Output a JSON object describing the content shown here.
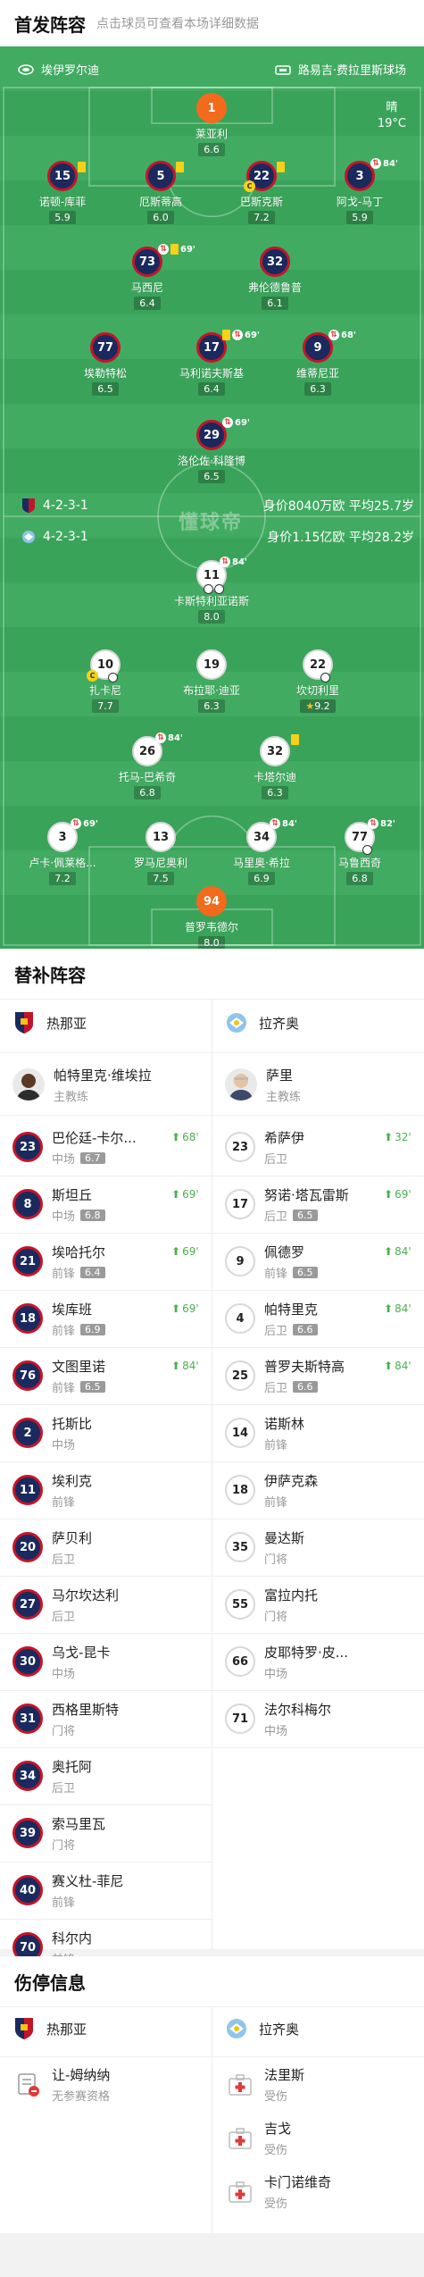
{
  "header": {
    "title": "首发阵容",
    "subtitle": "点击球员可查看本场详细数据"
  },
  "venue": {
    "home_name": "埃伊罗尔迪",
    "away_name": "路易吉·费拉里斯球场",
    "weather_label": "晴",
    "temperature": "19°C"
  },
  "watermark": "懂球帝",
  "home_team": {
    "formation": "4-2-3-1",
    "market_value": "身价8040万欧",
    "avg_age": "平均25.7岁"
  },
  "away_team": {
    "formation": "4-2-3-1",
    "market_value": "身价1.15亿欧",
    "avg_age": "平均28.2岁"
  },
  "home_players": [
    {
      "num": "1",
      "name": "莱亚利",
      "rating": "6.6"
    },
    {
      "num": "15",
      "name": "诺顿-库菲",
      "rating": "5.9"
    },
    {
      "num": "5",
      "name": "厄斯蒂高",
      "rating": "6.0"
    },
    {
      "num": "22",
      "name": "巴斯克斯",
      "rating": "7.2"
    },
    {
      "num": "3",
      "name": "阿戈-马丁",
      "rating": "5.9",
      "sub": "84'"
    },
    {
      "num": "73",
      "name": "马西尼",
      "rating": "6.4",
      "sub": "69'"
    },
    {
      "num": "32",
      "name": "弗伦德鲁普",
      "rating": "6.1"
    },
    {
      "num": "77",
      "name": "埃勒特松",
      "rating": "6.5"
    },
    {
      "num": "17",
      "name": "马利诺夫斯基",
      "rating": "6.4",
      "sub": "69'"
    },
    {
      "num": "9",
      "name": "维蒂尼亚",
      "rating": "6.3",
      "sub": "68'"
    },
    {
      "num": "29",
      "name": "洛伦佐·科隆博",
      "rating": "6.5",
      "sub": "69'"
    }
  ],
  "away_players": [
    {
      "num": "11",
      "name": "卡斯特利亚诺斯",
      "rating": "8.0",
      "sub": "84'"
    },
    {
      "num": "10",
      "name": "扎卡尼",
      "rating": "7.7"
    },
    {
      "num": "19",
      "name": "布拉耶·迪亚",
      "rating": "6.3"
    },
    {
      "num": "22",
      "name": "坎切利里",
      "rating": "9.2"
    },
    {
      "num": "26",
      "name": "托马-巴希奇",
      "rating": "6.8",
      "sub": "84'"
    },
    {
      "num": "32",
      "name": "卡塔尔迪",
      "rating": "6.3"
    },
    {
      "num": "3",
      "name": "卢卡·佩莱格...",
      "rating": "7.2",
      "sub": "69'"
    },
    {
      "num": "13",
      "name": "罗马尼奥利",
      "rating": "7.5"
    },
    {
      "num": "34",
      "name": "马里奥·希拉",
      "rating": "6.9",
      "sub": "84'"
    },
    {
      "num": "77",
      "name": "马鲁西奇",
      "rating": "6.8",
      "sub": "82'"
    },
    {
      "num": "94",
      "name": "普罗韦德尔",
      "rating": "8.0"
    }
  ],
  "subs": {
    "title": "替补阵容",
    "home_team": "热那亚",
    "away_team": "拉齐奥",
    "home_coach": {
      "name": "帕特里克·维埃拉",
      "role": "主教练"
    },
    "away_coach": {
      "name": "萨里",
      "role": "主教练"
    },
    "home": [
      {
        "num": "23",
        "name": "巴伦廷-卡尔...",
        "pos": "中场",
        "rating": "6.7",
        "in": "68'"
      },
      {
        "num": "8",
        "name": "斯坦丘",
        "pos": "中场",
        "rating": "6.8",
        "in": "69'"
      },
      {
        "num": "21",
        "name": "埃哈托尔",
        "pos": "前锋",
        "rating": "6.4",
        "in": "69'"
      },
      {
        "num": "18",
        "name": "埃库班",
        "pos": "前锋",
        "rating": "6.9",
        "in": "69'"
      },
      {
        "num": "76",
        "name": "文图里诺",
        "pos": "前锋",
        "rating": "6.5",
        "in": "84'"
      },
      {
        "num": "2",
        "name": "托斯比",
        "pos": "中场"
      },
      {
        "num": "11",
        "name": "埃利克",
        "pos": "前锋"
      },
      {
        "num": "20",
        "name": "萨贝利",
        "pos": "后卫"
      },
      {
        "num": "27",
        "name": "马尔坎达利",
        "pos": "后卫"
      },
      {
        "num": "30",
        "name": "乌戈-昆卡",
        "pos": "中场"
      },
      {
        "num": "31",
        "name": "西格里斯特",
        "pos": "门将"
      },
      {
        "num": "34",
        "name": "奥托阿",
        "pos": "后卫"
      },
      {
        "num": "39",
        "name": "索马里瓦",
        "pos": "门将"
      },
      {
        "num": "40",
        "name": "赛义杜-菲尼",
        "pos": "前锋"
      },
      {
        "num": "70",
        "name": "科尔内",
        "pos": "前锋"
      }
    ],
    "away": [
      {
        "num": "23",
        "name": "希萨伊",
        "pos": "后卫",
        "in": "32'"
      },
      {
        "num": "17",
        "name": "努诺·塔瓦雷斯",
        "pos": "后卫",
        "rating": "6.5",
        "in": "69'"
      },
      {
        "num": "9",
        "name": "佩德罗",
        "pos": "前锋",
        "rating": "6.5",
        "in": "84'"
      },
      {
        "num": "4",
        "name": "帕特里克",
        "pos": "后卫",
        "rating": "6.6",
        "in": "84'"
      },
      {
        "num": "25",
        "name": "普罗夫斯特高",
        "pos": "后卫",
        "rating": "6.6",
        "in": "84'"
      },
      {
        "num": "14",
        "name": "诺斯林",
        "pos": "前锋"
      },
      {
        "num": "18",
        "name": "伊萨克森",
        "pos": "前锋"
      },
      {
        "num": "35",
        "name": "曼达斯",
        "pos": "门将"
      },
      {
        "num": "55",
        "name": "富拉内托",
        "pos": "门将"
      },
      {
        "num": "66",
        "name": "皮耶特罗·皮...",
        "pos": "中场"
      },
      {
        "num": "71",
        "name": "法尔科梅尔",
        "pos": "中场"
      }
    ]
  },
  "injuries": {
    "title": "伤停信息",
    "home_team": "热那亚",
    "away_team": "拉齐奥",
    "home": [
      {
        "name": "让-姆纳纳",
        "status": "无参赛资格"
      }
    ],
    "away": [
      {
        "name": "法里斯",
        "status": "受伤"
      },
      {
        "name": "吉戈",
        "status": "受伤"
      },
      {
        "name": "卡门诺维奇",
        "status": "受伤"
      }
    ]
  },
  "colors": {
    "pitch": "#3aa35a",
    "home_primary": "#1a2a5e",
    "home_secondary": "#c2152a",
    "goalkeeper": "#f26a1b",
    "sub_in": "#4caf50"
  }
}
